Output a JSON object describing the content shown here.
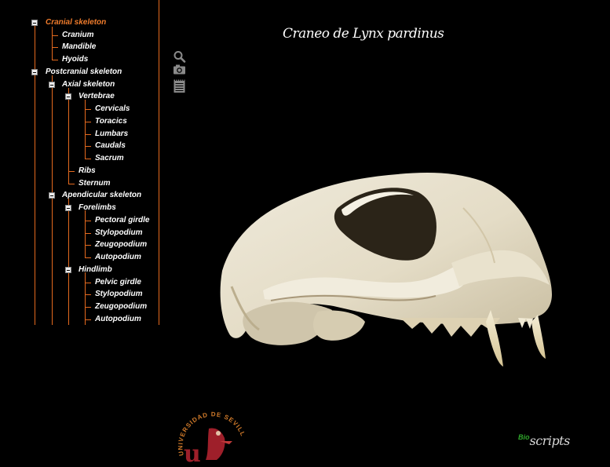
{
  "app": {
    "title": "Craneo de Lynx pardinus",
    "accent_color": "#f07c2c",
    "line_color": "#e56a1e",
    "background_color": "#000000"
  },
  "tree": {
    "cranial": {
      "label": "Cranial skeleton",
      "children": {
        "cranium": "Cranium",
        "mandible": "Mandible",
        "hyoids": "Hyoids"
      }
    },
    "postcranial": {
      "label": "Postcranial skeleton",
      "axial": {
        "label": "Axial skeleton",
        "vertebrae": {
          "label": "Vertebrae",
          "children": {
            "cervicals": "Cervicals",
            "toracics": "Toracics",
            "lumbars": "Lumbars",
            "caudals": "Caudals",
            "sacrum": "Sacrum"
          }
        },
        "ribs": "Ribs",
        "sternum": "Sternum"
      },
      "apendicular": {
        "label": "Apendicular skeleton",
        "forelimbs": {
          "label": "Forelimbs",
          "children": {
            "pectoral": "Pectoral girdle",
            "stylopodium": "Stylopodium",
            "zeugopodium": "Zeugopodium",
            "autopodium": "Autopodium"
          }
        },
        "hindlimb": {
          "label": "Hindlimb",
          "children": {
            "pelvic": "Pelvic girdle",
            "stylopodium": "Stylopodium",
            "zeugopodium": "Zeugopodium",
            "autopodium": "Autopodium"
          }
        }
      }
    }
  },
  "toolbar": {
    "icons": [
      "search-icon",
      "camera-icon",
      "notepad-icon"
    ]
  },
  "logos": {
    "university_text": "UNIVERSIDAD DE SEVILLA",
    "bioscripts_bio": "Bio",
    "bioscripts_scripts": "scripts"
  }
}
